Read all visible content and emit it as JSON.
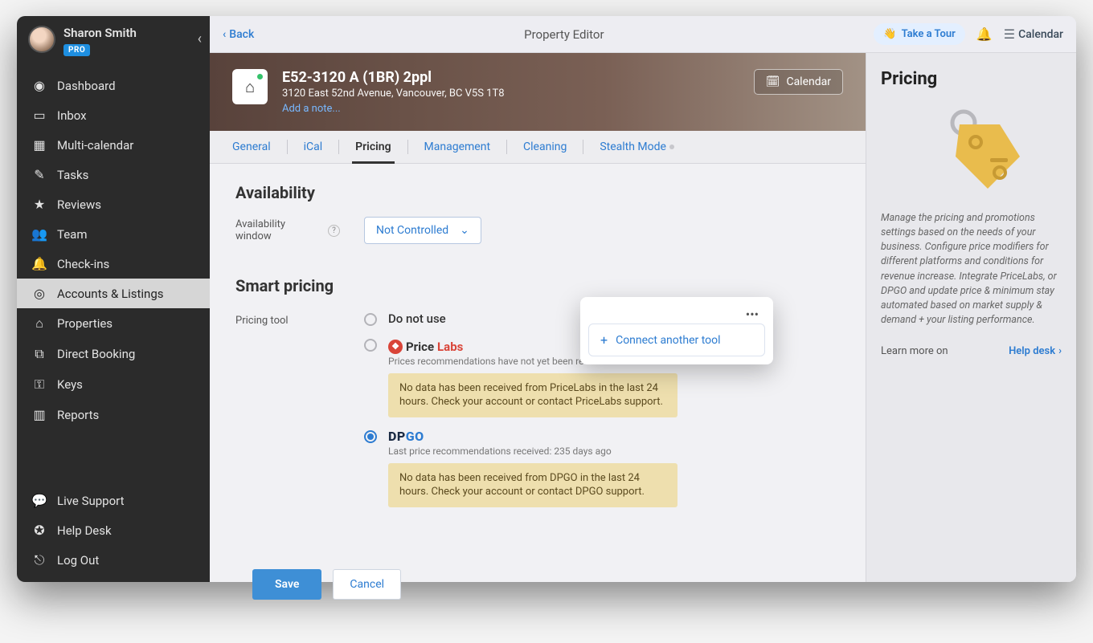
{
  "user": {
    "name": "Sharon Smith",
    "badge": "PRO"
  },
  "sidebar": {
    "items": [
      {
        "label": "Dashboard"
      },
      {
        "label": "Inbox"
      },
      {
        "label": "Multi-calendar"
      },
      {
        "label": "Tasks"
      },
      {
        "label": "Reviews"
      },
      {
        "label": "Team"
      },
      {
        "label": "Check-ins"
      },
      {
        "label": "Accounts & Listings"
      },
      {
        "label": "Properties"
      },
      {
        "label": "Direct Booking"
      },
      {
        "label": "Keys"
      },
      {
        "label": "Reports"
      }
    ],
    "bottom": [
      {
        "label": "Live Support"
      },
      {
        "label": "Help Desk"
      },
      {
        "label": "Log Out"
      }
    ]
  },
  "topbar": {
    "back": "Back",
    "title": "Property Editor",
    "tour": "Take a Tour",
    "calendar": "Calendar"
  },
  "hero": {
    "title": "E52-3120 A (1BR) 2ppl",
    "address": "3120 East 52nd Avenue, Vancouver, BC V5S 1T8",
    "note_link": "Add a note...",
    "calendar_btn": "Calendar"
  },
  "tabs": [
    "General",
    "iCal",
    "Pricing",
    "Management",
    "Cleaning",
    "Stealth Mode"
  ],
  "availability": {
    "heading": "Availability",
    "window_label": "Availability window",
    "window_value": "Not Controlled"
  },
  "smart": {
    "heading": "Smart pricing",
    "tool_label": "Pricing tool",
    "options": {
      "none": "Do not use",
      "pricelabs": {
        "name": "PriceLabs",
        "sub": "Prices recommendations have not yet been received",
        "alert": "No data has been received from PriceLabs in the last 24 hours. Check your account or contact PriceLabs support."
      },
      "dpgo": {
        "name": "DPGO",
        "sub": "Last price recommendations received: 235 days ago",
        "alert": "No data has been received from DPGO in the last 24 hours. Check your account or contact DPGO support."
      }
    }
  },
  "popover": {
    "action": "Connect another tool"
  },
  "footer": {
    "save": "Save",
    "cancel": "Cancel"
  },
  "right": {
    "title": "Pricing",
    "body": "Manage the pricing and promotions settings based on the needs of your business. Configure price modifiers for different platforms and conditions for revenue increase. Integrate PriceLabs, or DPGO and update price & minimum stay automated based on market supply & demand + your listing performance.",
    "learn_label": "Learn more on",
    "help_link": "Help desk"
  }
}
